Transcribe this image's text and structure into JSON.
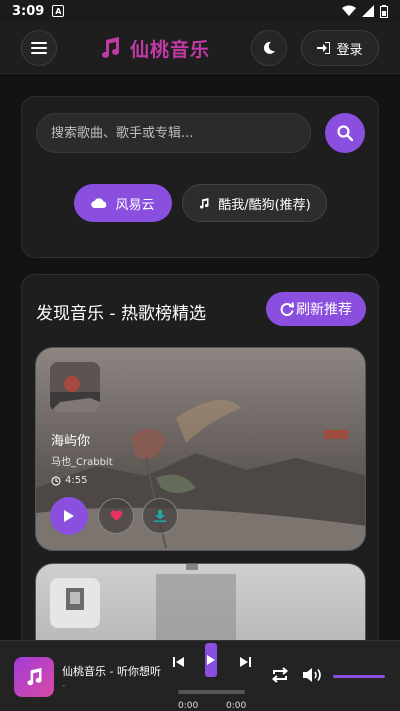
{
  "status_bar": {
    "time": "3:09",
    "app_letter": "A",
    "icons": [
      "wifi-icon",
      "signal-icon",
      "battery-icon"
    ]
  },
  "header": {
    "title": "仙桃音乐",
    "login_label": "登录",
    "icons": [
      "menu-icon",
      "music-note-icon",
      "moon-icon",
      "login-icon"
    ]
  },
  "search": {
    "placeholder": "搜索歌曲、歌手或专辑...",
    "value": ""
  },
  "sources": [
    {
      "label": "风易云",
      "icon": "cloud-icon",
      "selected": true
    },
    {
      "label": "酷我/酷狗(推荐)",
      "icon": "music-note-icon",
      "selected": false
    }
  ],
  "discover": {
    "title": "发现音乐 - 热歌榜精选",
    "refresh_label": "刷新推荐"
  },
  "songs": [
    {
      "name": "海屿你",
      "artist": "马也_Crabbit",
      "duration": "4:55"
    },
    {
      "name": "",
      "artist": "",
      "duration": ""
    }
  ],
  "player": {
    "title": "仙桃音乐 - 听你想听",
    "subtitle": "-",
    "current_time": "0:00",
    "total_time": "0:00",
    "progress": 0,
    "volume": 1.0
  },
  "colors": {
    "accent": "#8b4fe0",
    "brand": "#c23aa5",
    "background": "#131313"
  }
}
